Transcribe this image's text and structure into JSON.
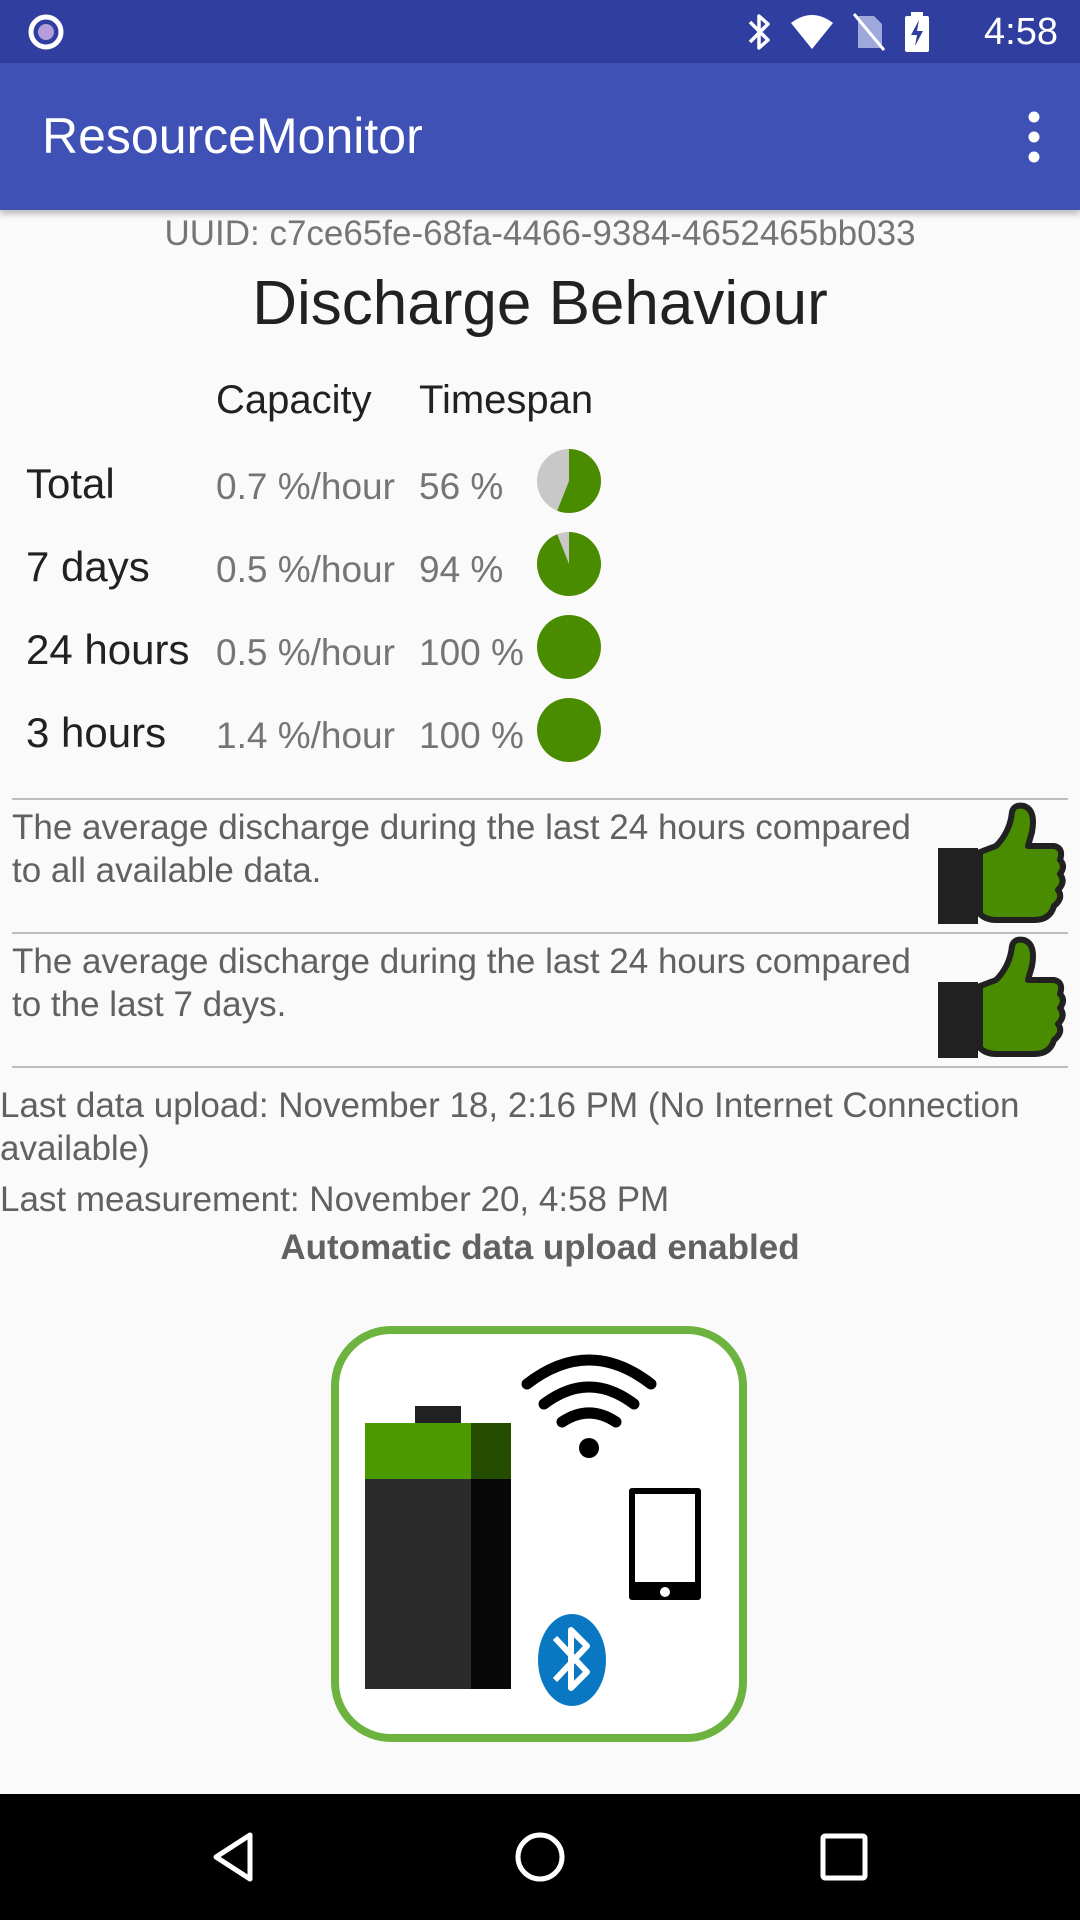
{
  "status_bar": {
    "time": "4:58",
    "icons": [
      "notification-dot-icon",
      "bluetooth-icon",
      "wifi-icon",
      "no-sim-icon",
      "battery-charging-icon"
    ]
  },
  "app_bar": {
    "title": "ResourceMonitor",
    "overflow_icon": "more-vert-icon"
  },
  "uuid": "UUID: c7ce65fe-68fa-4466-9384-4652465bb033",
  "heading": "Discharge Behaviour",
  "table": {
    "headers": {
      "capacity": "Capacity",
      "timespan": "Timespan"
    },
    "rows": [
      {
        "label": "Total",
        "capacity": "0.7 %/hour",
        "timespan": "56 %",
        "fraction": 0.56
      },
      {
        "label": "7 days",
        "capacity": "0.5 %/hour",
        "timespan": "94 %",
        "fraction": 0.94
      },
      {
        "label": "24 hours",
        "capacity": "0.5 %/hour",
        "timespan": "100 %",
        "fraction": 1.0
      },
      {
        "label": "3 hours",
        "capacity": "1.4 %/hour",
        "timespan": "100 %",
        "fraction": 1.0
      }
    ]
  },
  "comparisons": [
    {
      "text": "The average discharge during the last 24 hours compared to all available data.",
      "icon": "thumbs-up-icon"
    },
    {
      "text": "The average discharge during the last 24 hours compared to the last 7 days.",
      "icon": "thumbs-up-icon"
    }
  ],
  "last_upload": "Last data upload: November 18, 2:16 PM (No Internet Connection available)",
  "last_measurement": "Last measurement: November 20, 4:58 PM",
  "auto_upload": "Automatic data upload enabled",
  "colors": {
    "primary": "#3f51b5",
    "primary_dark": "#303f9f",
    "pie_green": "#4a8c00",
    "pie_grey": "#c8c8c8",
    "logo_border": "#6db33f",
    "bluetooth_blue": "#0a77c2"
  },
  "nav": [
    "back-icon",
    "home-icon",
    "recents-icon"
  ]
}
